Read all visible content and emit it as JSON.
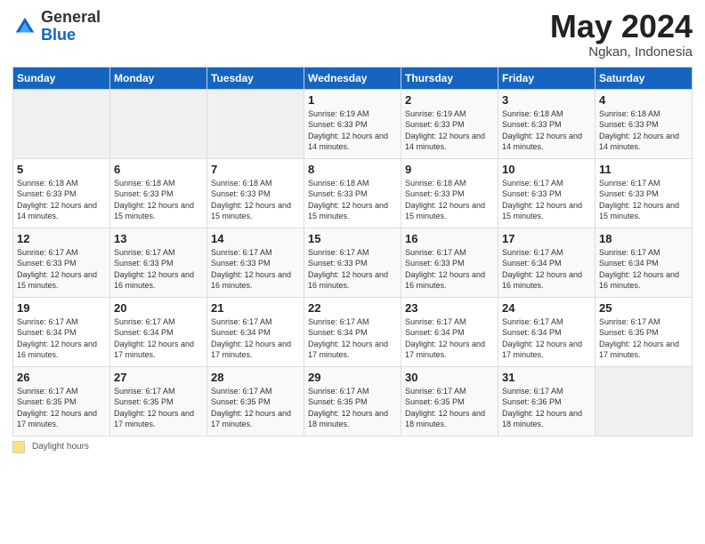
{
  "header": {
    "logo_general": "General",
    "logo_blue": "Blue",
    "title": "May 2024",
    "location": "Ngkan, Indonesia"
  },
  "days_of_week": [
    "Sunday",
    "Monday",
    "Tuesday",
    "Wednesday",
    "Thursday",
    "Friday",
    "Saturday"
  ],
  "footer": {
    "swatch_label": "Daylight hours"
  },
  "weeks": [
    [
      {
        "day": "",
        "info": ""
      },
      {
        "day": "",
        "info": ""
      },
      {
        "day": "",
        "info": ""
      },
      {
        "day": "1",
        "info": "Sunrise: 6:19 AM\nSunset: 6:33 PM\nDaylight: 12 hours\nand 14 minutes."
      },
      {
        "day": "2",
        "info": "Sunrise: 6:19 AM\nSunset: 6:33 PM\nDaylight: 12 hours\nand 14 minutes."
      },
      {
        "day": "3",
        "info": "Sunrise: 6:18 AM\nSunset: 6:33 PM\nDaylight: 12 hours\nand 14 minutes."
      },
      {
        "day": "4",
        "info": "Sunrise: 6:18 AM\nSunset: 6:33 PM\nDaylight: 12 hours\nand 14 minutes."
      }
    ],
    [
      {
        "day": "5",
        "info": "Sunrise: 6:18 AM\nSunset: 6:33 PM\nDaylight: 12 hours\nand 14 minutes."
      },
      {
        "day": "6",
        "info": "Sunrise: 6:18 AM\nSunset: 6:33 PM\nDaylight: 12 hours\nand 15 minutes."
      },
      {
        "day": "7",
        "info": "Sunrise: 6:18 AM\nSunset: 6:33 PM\nDaylight: 12 hours\nand 15 minutes."
      },
      {
        "day": "8",
        "info": "Sunrise: 6:18 AM\nSunset: 6:33 PM\nDaylight: 12 hours\nand 15 minutes."
      },
      {
        "day": "9",
        "info": "Sunrise: 6:18 AM\nSunset: 6:33 PM\nDaylight: 12 hours\nand 15 minutes."
      },
      {
        "day": "10",
        "info": "Sunrise: 6:17 AM\nSunset: 6:33 PM\nDaylight: 12 hours\nand 15 minutes."
      },
      {
        "day": "11",
        "info": "Sunrise: 6:17 AM\nSunset: 6:33 PM\nDaylight: 12 hours\nand 15 minutes."
      }
    ],
    [
      {
        "day": "12",
        "info": "Sunrise: 6:17 AM\nSunset: 6:33 PM\nDaylight: 12 hours\nand 15 minutes."
      },
      {
        "day": "13",
        "info": "Sunrise: 6:17 AM\nSunset: 6:33 PM\nDaylight: 12 hours\nand 16 minutes."
      },
      {
        "day": "14",
        "info": "Sunrise: 6:17 AM\nSunset: 6:33 PM\nDaylight: 12 hours\nand 16 minutes."
      },
      {
        "day": "15",
        "info": "Sunrise: 6:17 AM\nSunset: 6:33 PM\nDaylight: 12 hours\nand 16 minutes."
      },
      {
        "day": "16",
        "info": "Sunrise: 6:17 AM\nSunset: 6:33 PM\nDaylight: 12 hours\nand 16 minutes."
      },
      {
        "day": "17",
        "info": "Sunrise: 6:17 AM\nSunset: 6:34 PM\nDaylight: 12 hours\nand 16 minutes."
      },
      {
        "day": "18",
        "info": "Sunrise: 6:17 AM\nSunset: 6:34 PM\nDaylight: 12 hours\nand 16 minutes."
      }
    ],
    [
      {
        "day": "19",
        "info": "Sunrise: 6:17 AM\nSunset: 6:34 PM\nDaylight: 12 hours\nand 16 minutes."
      },
      {
        "day": "20",
        "info": "Sunrise: 6:17 AM\nSunset: 6:34 PM\nDaylight: 12 hours\nand 17 minutes."
      },
      {
        "day": "21",
        "info": "Sunrise: 6:17 AM\nSunset: 6:34 PM\nDaylight: 12 hours\nand 17 minutes."
      },
      {
        "day": "22",
        "info": "Sunrise: 6:17 AM\nSunset: 6:34 PM\nDaylight: 12 hours\nand 17 minutes."
      },
      {
        "day": "23",
        "info": "Sunrise: 6:17 AM\nSunset: 6:34 PM\nDaylight: 12 hours\nand 17 minutes."
      },
      {
        "day": "24",
        "info": "Sunrise: 6:17 AM\nSunset: 6:34 PM\nDaylight: 12 hours\nand 17 minutes."
      },
      {
        "day": "25",
        "info": "Sunrise: 6:17 AM\nSunset: 6:35 PM\nDaylight: 12 hours\nand 17 minutes."
      }
    ],
    [
      {
        "day": "26",
        "info": "Sunrise: 6:17 AM\nSunset: 6:35 PM\nDaylight: 12 hours\nand 17 minutes."
      },
      {
        "day": "27",
        "info": "Sunrise: 6:17 AM\nSunset: 6:35 PM\nDaylight: 12 hours\nand 17 minutes."
      },
      {
        "day": "28",
        "info": "Sunrise: 6:17 AM\nSunset: 6:35 PM\nDaylight: 12 hours\nand 17 minutes."
      },
      {
        "day": "29",
        "info": "Sunrise: 6:17 AM\nSunset: 6:35 PM\nDaylight: 12 hours\nand 18 minutes."
      },
      {
        "day": "30",
        "info": "Sunrise: 6:17 AM\nSunset: 6:35 PM\nDaylight: 12 hours\nand 18 minutes."
      },
      {
        "day": "31",
        "info": "Sunrise: 6:17 AM\nSunset: 6:36 PM\nDaylight: 12 hours\nand 18 minutes."
      },
      {
        "day": "",
        "info": ""
      }
    ]
  ]
}
